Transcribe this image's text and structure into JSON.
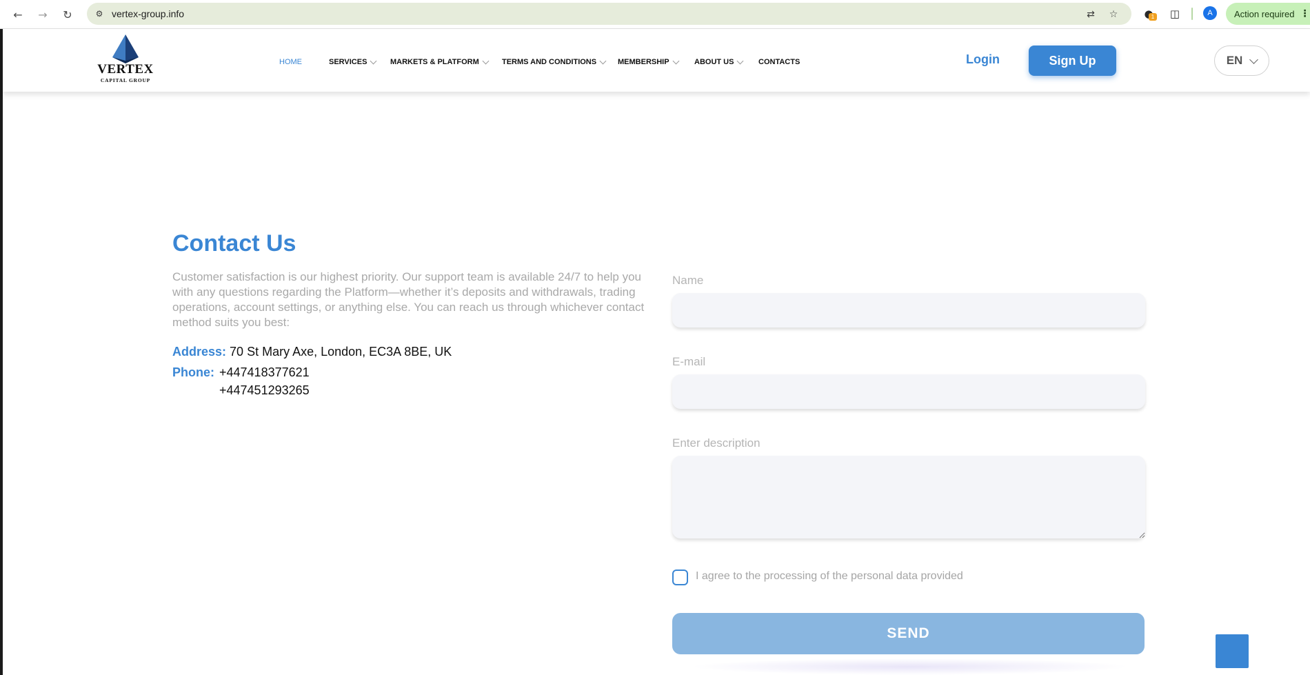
{
  "browser": {
    "url": "vertex-group.info",
    "action_label": "Action required",
    "profile_initial": "A",
    "extension_badge": "1",
    "icons": {
      "back": "back-arrow-icon",
      "forward": "forward-arrow-icon",
      "reload": "reload-icon",
      "site_info": "tune-icon",
      "translate": "translate-icon",
      "bookmark": "star-icon",
      "extension": "extension-icon",
      "puzzle": "puzzle-icon",
      "menu": "kebab-menu-icon"
    }
  },
  "header": {
    "logo": {
      "word": "VERTEX",
      "sub": "CAPITAL GROUP"
    },
    "menu": [
      {
        "label": "HOME",
        "active": true,
        "has_dropdown": false
      },
      {
        "label": "SERVICES",
        "active": false,
        "has_dropdown": true
      },
      {
        "label": "MARKETS & PLATFORM",
        "active": false,
        "has_dropdown": true
      },
      {
        "label": "TERMS AND CONDITIONS",
        "active": false,
        "has_dropdown": true
      },
      {
        "label": "MEMBERSHIP",
        "active": false,
        "has_dropdown": true
      },
      {
        "label": "ABOUT US",
        "active": false,
        "has_dropdown": true
      },
      {
        "label": "CONTACTS",
        "active": false,
        "has_dropdown": false
      }
    ],
    "login_label": "Login",
    "signup_label": "Sign Up",
    "language": "EN"
  },
  "contact": {
    "title": "Contact Us",
    "intro": "Customer satisfaction is our highest priority. Our support team is available 24/7 to help you with any questions regarding the Platform—whether it’s deposits and withdrawals, trading operations, account settings, or anything else. You can reach us through whichever contact method suits you best:",
    "address_label": "Address:",
    "address_value": "70 St Mary Axe, London, EC3A 8BE, UK",
    "phone_label": "Phone:",
    "phones": [
      "+447418377621",
      "+447451293265"
    ]
  },
  "form": {
    "name_label": "Name",
    "name_value": "",
    "email_label": "E-mail",
    "email_value": "",
    "description_label": "Enter description",
    "description_value": "",
    "agree_label": "I agree to the processing of the personal data provided",
    "agree_checked": false,
    "send_label": "SEND"
  },
  "colors": {
    "accent": "#3a86d4",
    "send_disabled": "#89b6e0",
    "muted_text": "#a9a9a9",
    "input_bg": "#f4f5f9",
    "omnibox_bg": "#e6ecdb",
    "action_pill_bg": "#c7f0b8"
  }
}
